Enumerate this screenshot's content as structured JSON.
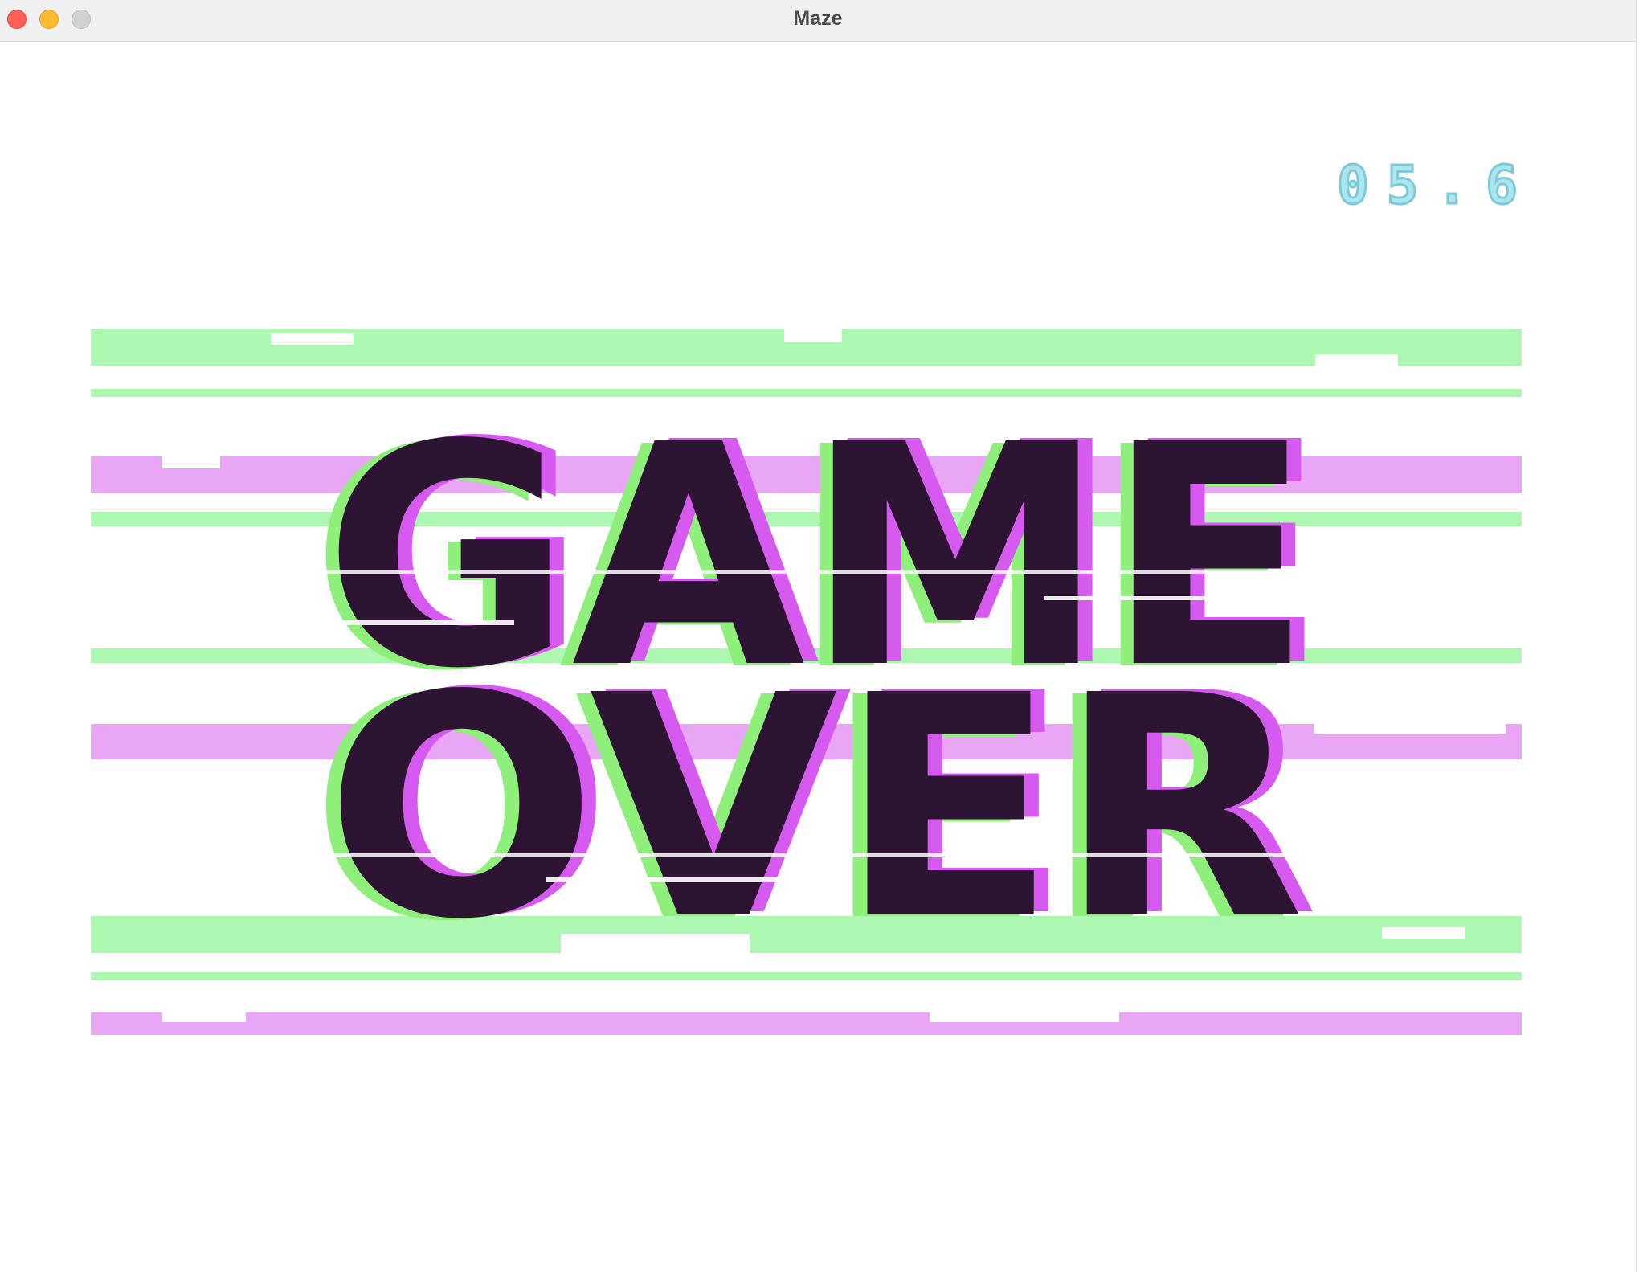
{
  "window": {
    "title": "Maze"
  },
  "hud": {
    "timer": "05.6"
  },
  "game_over": {
    "line1": "GAME",
    "line2": "OVER"
  },
  "colors": {
    "text": "#2e1433",
    "green": "#adf8b0",
    "green_shadow": "#8ef07a",
    "magenta": "#e8a6f4",
    "magenta_shadow": "#d75af0",
    "timer": "#a9e6ef"
  },
  "icons": {
    "close": "close-icon",
    "minimize": "minimize-icon",
    "zoom": "zoom-icon"
  }
}
